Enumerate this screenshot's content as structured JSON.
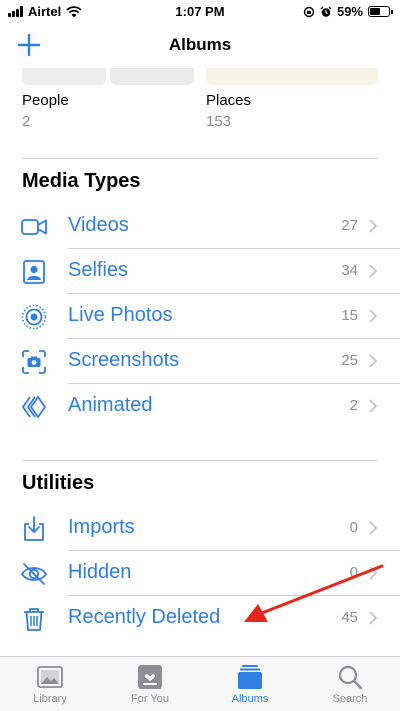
{
  "status_bar": {
    "carrier": "Airtel",
    "time": "1:07 PM",
    "battery": "59%",
    "battery_level": 0.59
  },
  "nav": {
    "title": "Albums"
  },
  "albums": [
    {
      "name": "People",
      "count": "2"
    },
    {
      "name": "Places",
      "count": "153"
    }
  ],
  "media_types": {
    "title": "Media Types",
    "items": [
      {
        "label": "Videos",
        "count": "27",
        "icon": "video-icon"
      },
      {
        "label": "Selfies",
        "count": "34",
        "icon": "selfie-icon"
      },
      {
        "label": "Live Photos",
        "count": "15",
        "icon": "live-photo-icon"
      },
      {
        "label": "Screenshots",
        "count": "25",
        "icon": "screenshot-icon"
      },
      {
        "label": "Animated",
        "count": "2",
        "icon": "animated-icon"
      }
    ]
  },
  "utilities": {
    "title": "Utilities",
    "items": [
      {
        "label": "Imports",
        "count": "0",
        "icon": "import-icon"
      },
      {
        "label": "Hidden",
        "count": "0",
        "icon": "hidden-eye-icon"
      },
      {
        "label": "Recently Deleted",
        "count": "45",
        "icon": "trash-icon"
      }
    ]
  },
  "tabs": [
    {
      "label": "Library",
      "icon": "library-icon",
      "active": false
    },
    {
      "label": "For You",
      "icon": "for-you-icon",
      "active": false
    },
    {
      "label": "Albums",
      "icon": "albums-icon",
      "active": true
    },
    {
      "label": "Search",
      "icon": "search-icon",
      "active": false
    }
  ],
  "colors": {
    "accent": "#2f7ee0",
    "annotation_arrow": "#e8261a",
    "secondary_text": "#8e8e93"
  }
}
